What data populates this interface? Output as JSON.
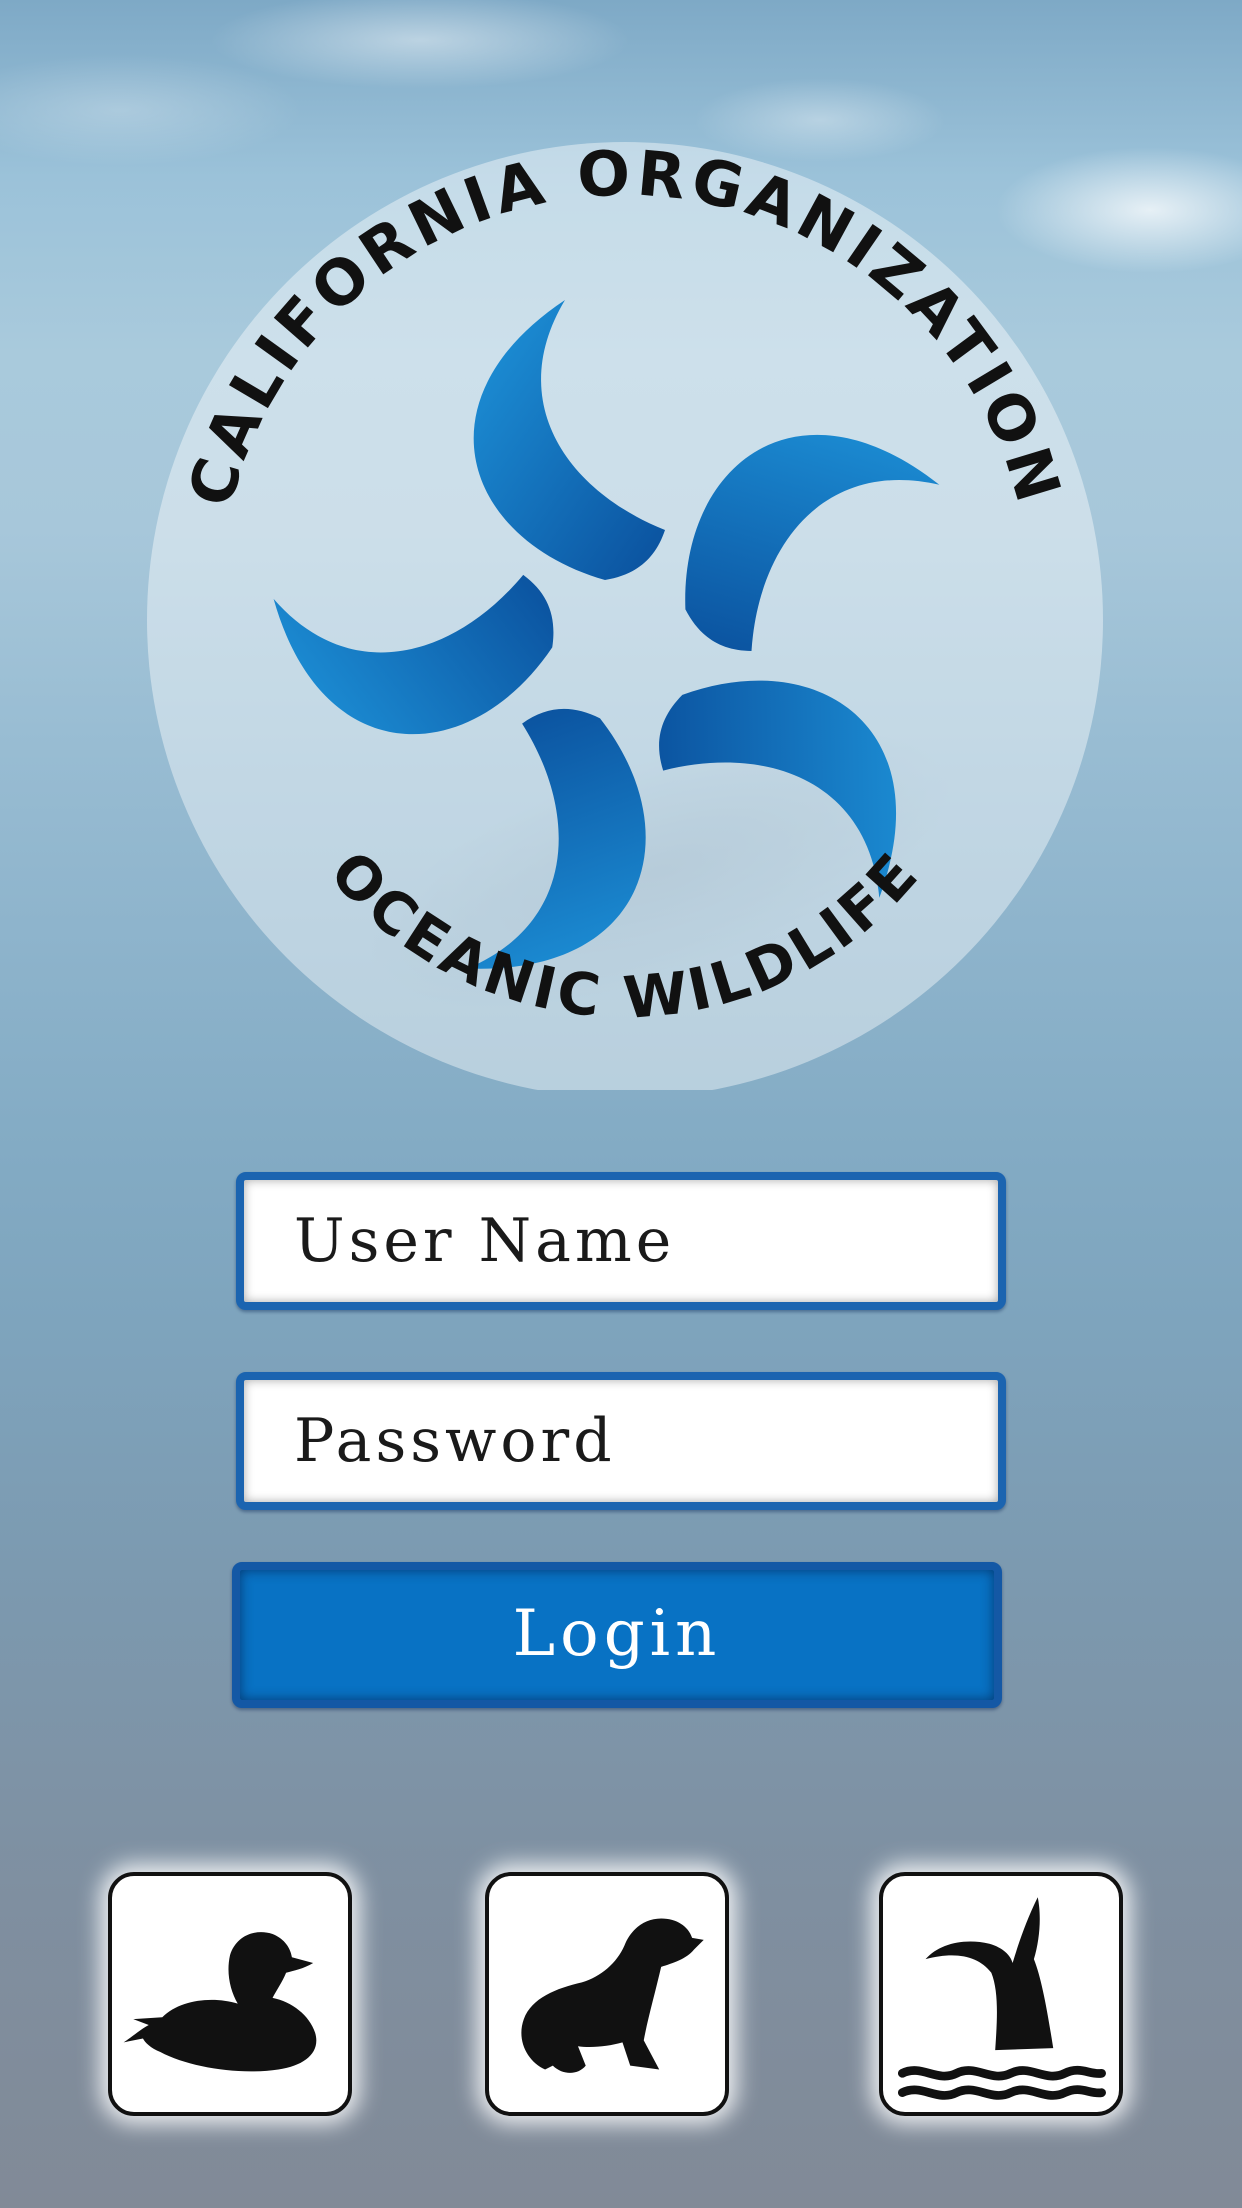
{
  "logo": {
    "top_text": "CALIFORNIA ORGANIZATION",
    "bottom_text": "OCEANIC WILDLIFE"
  },
  "login_form": {
    "username_placeholder": "User Name",
    "password_placeholder": "Password",
    "login_label": "Login"
  },
  "category_buttons": [
    {
      "icon": "duck-icon"
    },
    {
      "icon": "seal-icon"
    },
    {
      "icon": "whale-tail-icon"
    }
  ],
  "colors": {
    "accent": "#0872c4",
    "border": "#1b64b0",
    "logo_blue": "#0a6fb8"
  }
}
